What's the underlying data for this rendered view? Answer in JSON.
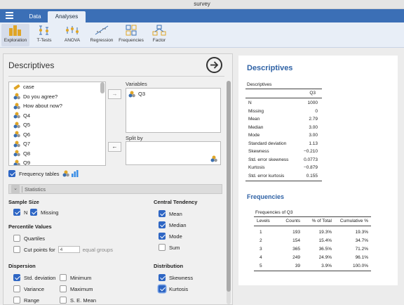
{
  "window": {
    "title": "survey"
  },
  "menubar": {
    "tabs": [
      "Data",
      "Analyses"
    ]
  },
  "toolbar": {
    "items": [
      {
        "label": "Exploration",
        "icon": "exploration-icon"
      },
      {
        "label": "T-Tests",
        "icon": "ttest-icon"
      },
      {
        "label": "ANOVA",
        "icon": "anova-icon"
      },
      {
        "label": "Regression",
        "icon": "regression-icon"
      },
      {
        "label": "Frequencies",
        "icon": "frequencies-icon"
      },
      {
        "label": "Factor",
        "icon": "factor-icon"
      }
    ]
  },
  "options": {
    "title": "Descriptives",
    "variables": [
      "case",
      "Do you agree?",
      "How about now?",
      "Q4",
      "Q5",
      "Q6",
      "Q7",
      "Q8",
      "Q9"
    ],
    "variables_label": "Variables",
    "selected_variables": [
      "Q3"
    ],
    "split_by_label": "Split by",
    "frequency_tables_label": "Frequency tables",
    "statistics_label": "Statistics",
    "sample_size": {
      "heading": "Sample Size",
      "n": "N",
      "missing": "Missing"
    },
    "percentile": {
      "heading": "Percentile Values",
      "quartiles": "Quartiles",
      "cut_points": "Cut points for",
      "cut_value": "4",
      "equal_groups": "equal groups"
    },
    "dispersion": {
      "heading": "Dispersion",
      "std_dev": "Std. deviation",
      "minimum": "Minimum",
      "variance": "Variance",
      "maximum": "Maximum",
      "range": "Range",
      "se_mean": "S. E. Mean"
    },
    "central_tendency": {
      "heading": "Central Tendency",
      "mean": "Mean",
      "median": "Median",
      "mode": "Mode",
      "sum": "Sum"
    },
    "distribution": {
      "heading": "Distribution",
      "skewness": "Skewness",
      "kurtosis": "Kurtosis"
    },
    "arrow_right": "→",
    "arrow_left": "←"
  },
  "results": {
    "title": "Descriptives",
    "descriptives_caption": "Descriptives",
    "descriptives_column": "Q3",
    "descriptives_rows": [
      [
        "N",
        "1000"
      ],
      [
        "Missing",
        "0"
      ],
      [
        "Mean",
        "2.79"
      ],
      [
        "Median",
        "3.00"
      ],
      [
        "Mode",
        "3.00"
      ],
      [
        "Standard deviation",
        "1.13"
      ],
      [
        "Skewness",
        "−0.210"
      ],
      [
        "Std. error skewness",
        "0.0773"
      ],
      [
        "Kurtosis",
        "−0.879"
      ],
      [
        "Std. error kurtosis",
        "0.155"
      ]
    ],
    "frequencies_title": "Frequencies",
    "frequencies_caption": "Frequencies of Q3",
    "frequencies_headers": [
      "Levels",
      "Counts",
      "% of Total",
      "Cumulative %"
    ],
    "frequencies_rows": [
      [
        "1",
        "193",
        "19.3%",
        "19.3%"
      ],
      [
        "2",
        "154",
        "15.4%",
        "34.7%"
      ],
      [
        "3",
        "365",
        "36.5%",
        "71.2%"
      ],
      [
        "4",
        "249",
        "24.9%",
        "96.1%"
      ],
      [
        "5",
        "39",
        "3.9%",
        "100.0%"
      ]
    ]
  },
  "colors": {
    "accent": "#3b6fb6",
    "result_heading": "#2f62a5",
    "checkbox": "#2e66c4"
  }
}
